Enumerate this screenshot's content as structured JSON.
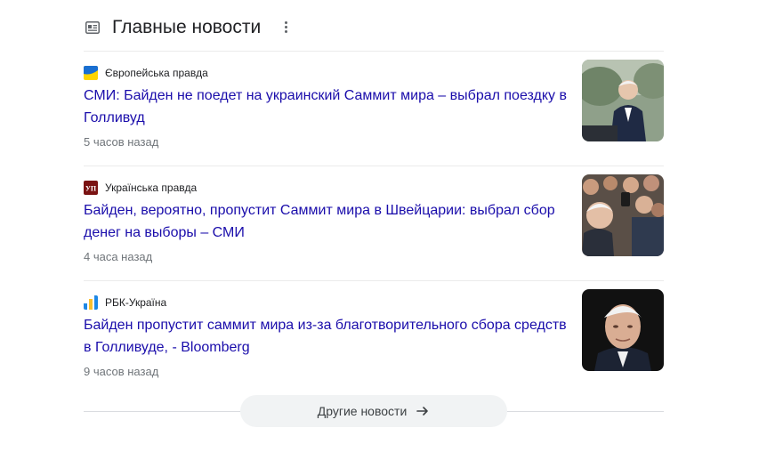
{
  "header": {
    "icon": "newspaper-icon",
    "title": "Главные новости",
    "menu_icon": "more-vert-icon"
  },
  "stories": [
    {
      "source": "Європейська правда",
      "source_icon": "ukraine-flag-favicon",
      "headline": "СМИ: Байден не поедет на украинский Саммит мира – выбрал поездку в Голливуд",
      "time": "5 часов назад",
      "thumbnail": "man-at-podium-photo"
    },
    {
      "source": "Українська правда",
      "source_icon": "up-logo-favicon",
      "favicon_text": "УП",
      "headline": "Байден, вероятно, пропустит Саммит мира в Швейцарии: выбрал сбор денег на выборы – СМИ",
      "time": "4 часа назад",
      "thumbnail": "crowd-selfie-photo"
    },
    {
      "source": "РБК-Україна",
      "source_icon": "rbc-bars-favicon",
      "headline": "Байден пропустит саммит мира из-за благотворительного сбора средств в Голливуде, - Bloomberg",
      "time": "9 часов назад",
      "thumbnail": "man-portrait-dark-photo"
    }
  ],
  "more": {
    "label": "Другие новости",
    "icon": "arrow-right-icon"
  },
  "colors": {
    "headline_link": "#1a0dab",
    "meta_text": "#70757a",
    "button_bg": "#f1f3f4"
  }
}
